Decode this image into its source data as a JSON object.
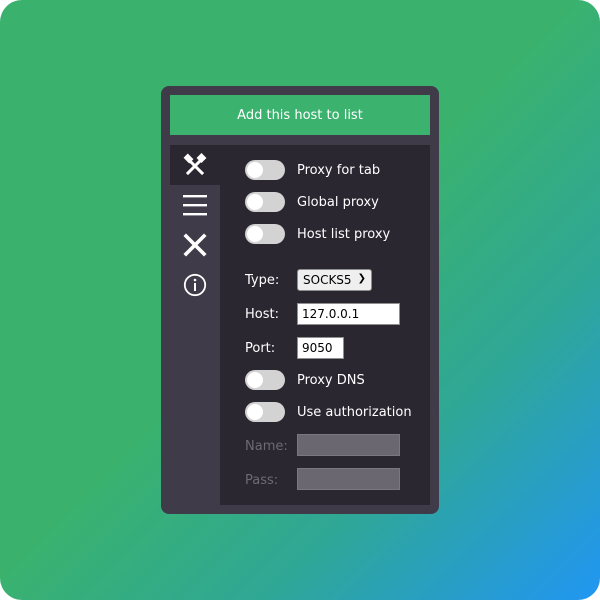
{
  "header": {
    "add_button_label": "Add this host to list"
  },
  "sidebar": {
    "items": [
      {
        "name": "tools",
        "icon": "hammer-pick-icon",
        "active": true
      },
      {
        "name": "list",
        "icon": "hamburger-list-icon"
      },
      {
        "name": "remove",
        "icon": "close-icon"
      },
      {
        "name": "info",
        "icon": "info-icon"
      }
    ]
  },
  "toggles": {
    "proxy_for_tab": {
      "label": "Proxy for tab",
      "on": false
    },
    "global_proxy": {
      "label": "Global proxy",
      "on": false
    },
    "host_list_proxy": {
      "label": "Host list proxy",
      "on": false
    },
    "proxy_dns": {
      "label": "Proxy DNS",
      "on": false
    },
    "use_authorization": {
      "label": "Use authorization",
      "on": false
    }
  },
  "settings": {
    "type_label": "Type:",
    "type_value": "SOCKS5",
    "host_label": "Host:",
    "host_value": "127.0.0.1",
    "port_label": "Port:",
    "port_value": "9050",
    "name_label": "Name:",
    "name_value": "",
    "pass_label": "Pass:",
    "pass_value": ""
  },
  "colors": {
    "accent": "#3cb26f",
    "panel": "#2a2731",
    "sidebar": "#403b48"
  }
}
